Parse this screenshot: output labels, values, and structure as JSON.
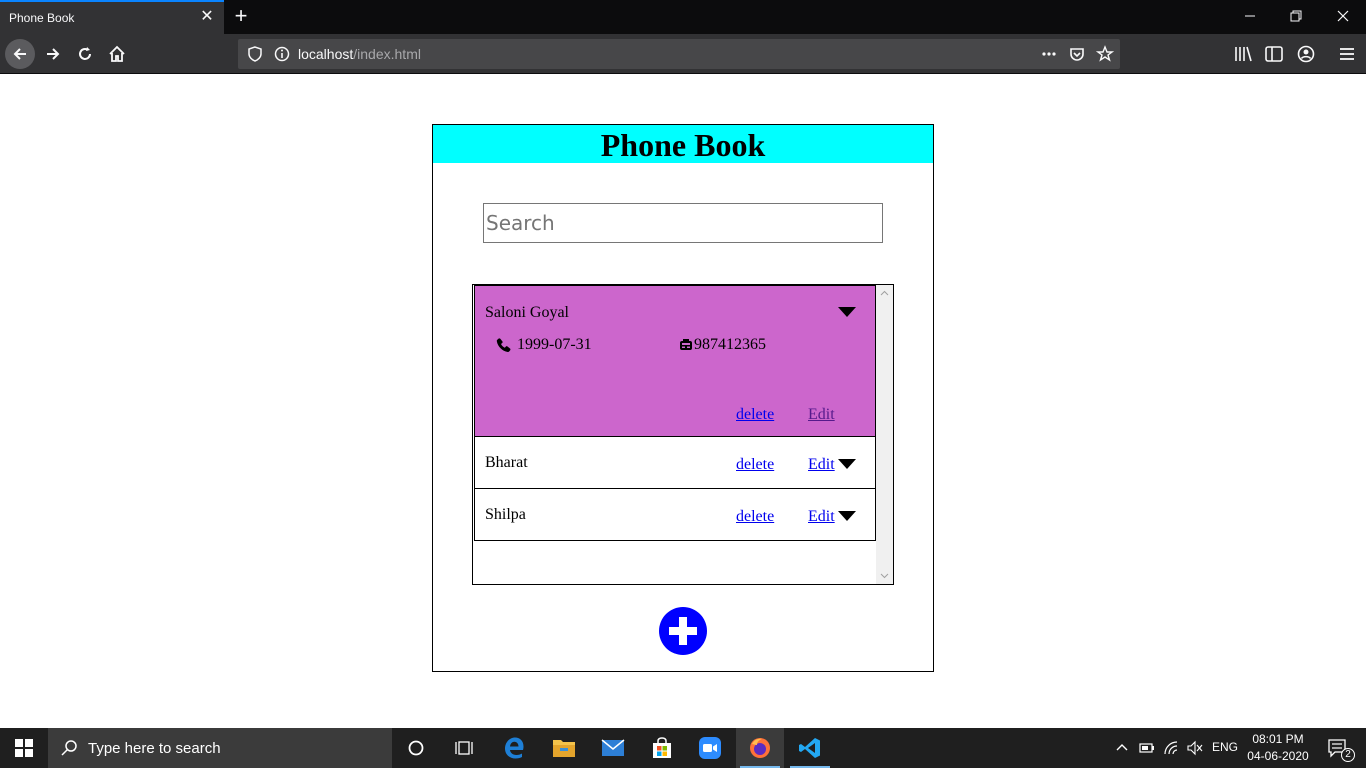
{
  "browser": {
    "tab_title": "Phone Book",
    "url_host": "localhost",
    "url_path": "/index.html"
  },
  "app": {
    "title": "Phone Book",
    "header_color": "#00ffff",
    "search_placeholder": "Search",
    "search_value": "",
    "expanded_color": "#cc66cc",
    "add_button_color": "#0000ff",
    "contacts": [
      {
        "name": "Saloni Goyal",
        "date": "1999-07-31",
        "phone": "987412365",
        "delete_label": "delete",
        "edit_label": "Edit",
        "expanded": true
      },
      {
        "name": "Bharat",
        "delete_label": "delete",
        "edit_label": "Edit",
        "expanded": false
      },
      {
        "name": "Shilpa",
        "delete_label": "delete",
        "edit_label": "Edit",
        "expanded": false
      }
    ]
  },
  "taskbar": {
    "search_placeholder": "Type here to search",
    "language": "ENG",
    "time": "08:01 PM",
    "date": "04-06-2020",
    "notification_count": "2"
  }
}
